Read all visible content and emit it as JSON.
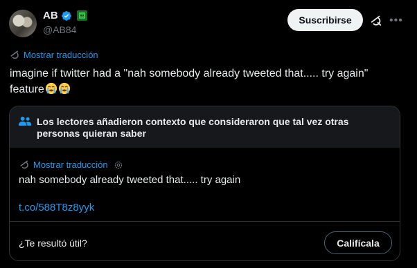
{
  "author": {
    "name": "AB",
    "handle": "@AB84",
    "verified": true,
    "avatar": "avatar-photo"
  },
  "header": {
    "subscribe_label": "Suscribirse",
    "grok_icon": "grok-icon",
    "more_icon": "more-icon"
  },
  "tweet": {
    "translate_label": "Mostrar traducción",
    "text": "imagine if twitter had a \"nah somebody already tweeted that..... try again\" feature",
    "emojis": [
      "crying-face",
      "crying-face"
    ]
  },
  "community_note": {
    "title": "Los lectores añadieron contexto que consideraron que tal vez otras personas quieran saber",
    "translate_label": "Mostrar traducción",
    "text": "nah somebody already tweeted that..... try again",
    "link": "t.co/588T8z8yyk",
    "helpful_question": "¿Te resultó útil?",
    "rate_label": "Califícala"
  },
  "colors": {
    "background": "#000000",
    "text": "#e7e9ea",
    "secondary": "#71767b",
    "accent": "#1d9bf0",
    "verified": "#1d9bf0"
  }
}
